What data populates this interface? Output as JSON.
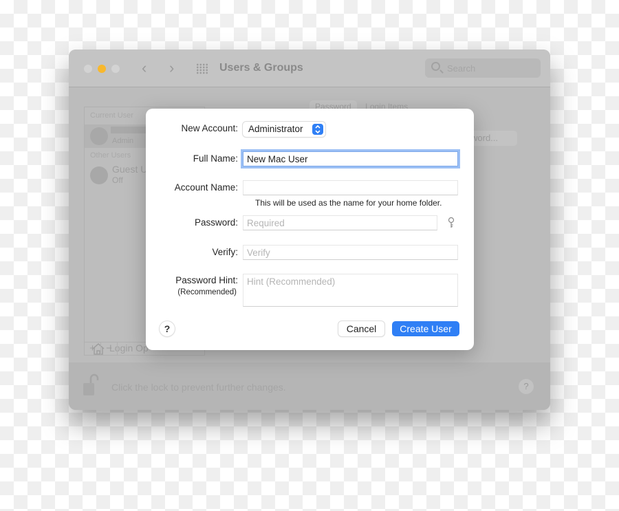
{
  "window": {
    "title": "Users & Groups",
    "search_placeholder": "Search",
    "tabs": [
      "Password",
      "Login Items"
    ],
    "change_password_label": "Change Password...",
    "change_password_visible": "ssword...",
    "sidebar": {
      "current_user_header": "Current User",
      "current_user_role": "Admin",
      "other_users_header": "Other Users",
      "guest_user_name": "Guest U",
      "guest_user_status": "Off",
      "login_options_label": "Login Op",
      "add_label": "+",
      "remove_label": "−"
    },
    "lock_text": "Click the lock to prevent further changes.",
    "help_label": "?"
  },
  "dialog": {
    "new_account_label": "New Account:",
    "new_account_value": "Administrator",
    "full_name_label": "Full Name:",
    "full_name_value": "New Mac User",
    "account_name_label": "Account Name:",
    "account_name_value": "",
    "account_name_note": "This will be used as the name for your home folder.",
    "password_label": "Password:",
    "password_placeholder": "Required",
    "verify_label": "Verify:",
    "verify_placeholder": "Verify",
    "hint_label": "Password Hint:",
    "hint_sublabel": "(Recommended)",
    "hint_placeholder": "Hint (Recommended)",
    "help_label": "?",
    "cancel_label": "Cancel",
    "create_label": "Create User"
  },
  "colors": {
    "accent": "#2f7ff5",
    "traffic_yellow": "#f8b82d",
    "focus_ring": "#9cc0f5"
  }
}
